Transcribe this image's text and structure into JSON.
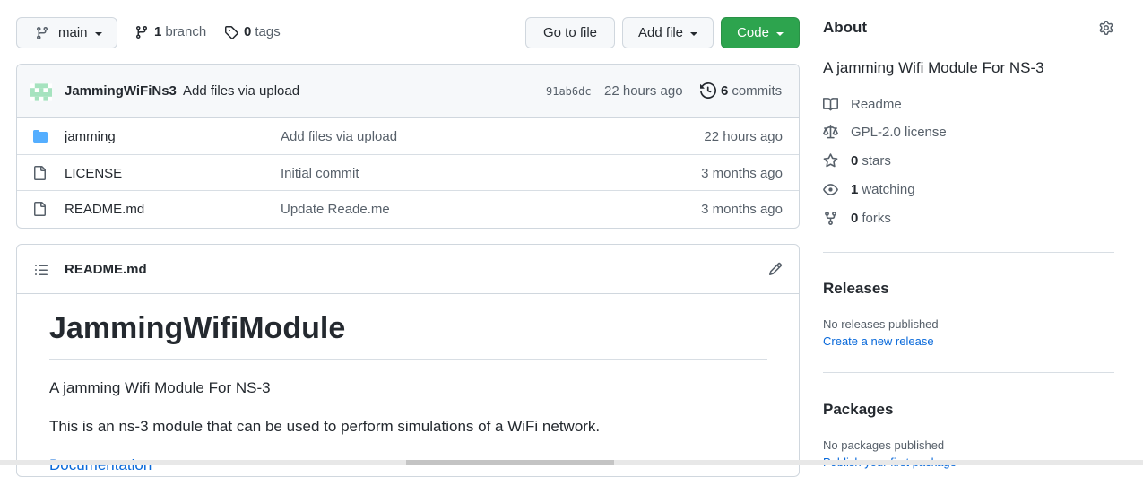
{
  "toolbar": {
    "branch_name": "main",
    "branch_count": "1",
    "branch_label": "branch",
    "tag_count": "0",
    "tag_label": "tags",
    "go_to_file": "Go to file",
    "add_file": "Add file",
    "code": "Code",
    "accent_color": "#2da44e"
  },
  "commit": {
    "author": "JammingWiFiNs3",
    "message": "Add files via upload",
    "hash": "91ab6dc",
    "time": "22 hours ago",
    "count": "6",
    "count_label": "commits"
  },
  "files": [
    {
      "icon": "folder-icon",
      "name": "jamming",
      "message": "Add files via upload",
      "time": "22 hours ago"
    },
    {
      "icon": "file-icon",
      "name": "LICENSE",
      "message": "Initial commit",
      "time": "3 months ago"
    },
    {
      "icon": "file-icon",
      "name": "README.md",
      "message": "Update Reade.me",
      "time": "3 months ago"
    }
  ],
  "readme": {
    "filename": "README.md",
    "heading": "JammingWifiModule",
    "paragraph1": "A jamming Wifi Module For NS-3",
    "paragraph2": "This is an ns-3 module that can be used to perform simulations of a WiFi network.",
    "link_partial": "Documentation"
  },
  "sidebar": {
    "about_title": "About",
    "description": "A jamming Wifi Module For NS-3",
    "readme": "Readme",
    "license": "GPL-2.0 license",
    "stars_count": "0",
    "stars_label": "stars",
    "watching_count": "1",
    "watching_label": "watching",
    "forks_count": "0",
    "forks_label": "forks",
    "releases_title": "Releases",
    "releases_none": "No releases published",
    "create_release": "Create a new release",
    "packages_title": "Packages",
    "packages_none": "No packages published",
    "publish_package": "Publish your first package"
  }
}
